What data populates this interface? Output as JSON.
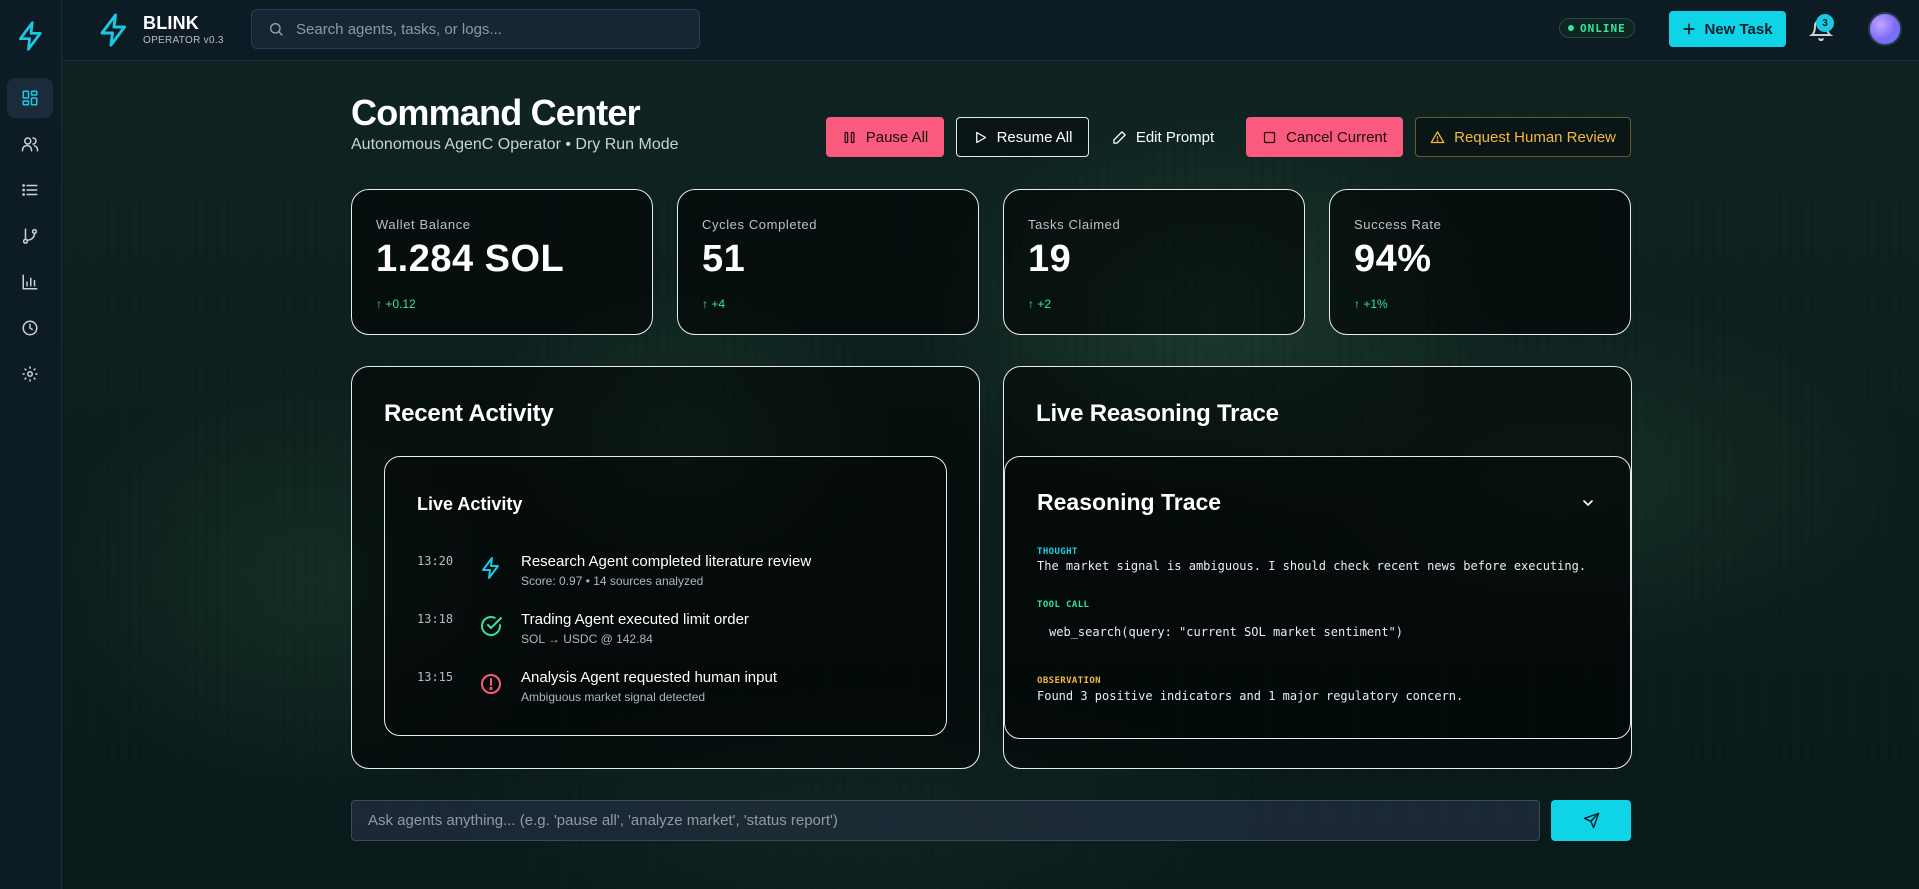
{
  "colors": {
    "accent": "#0fd4e8",
    "danger": "#fb5a7f",
    "warning": "#f5b740",
    "success": "#34e3a4",
    "thought_label": "#17d4e8",
    "tool_call_label": "#2ee6a2",
    "observation_label": "#f5b740"
  },
  "sidebar": {
    "items": [
      {
        "icon": "dashboard-icon",
        "active": true
      },
      {
        "icon": "users-icon",
        "active": false
      },
      {
        "icon": "list-icon",
        "active": false
      },
      {
        "icon": "git-branch-icon",
        "active": false
      },
      {
        "icon": "bar-chart-icon",
        "active": false
      },
      {
        "icon": "clock-icon",
        "active": false
      },
      {
        "icon": "settings-icon",
        "active": false
      }
    ]
  },
  "header": {
    "brand": "BLINK",
    "version": "OPERATOR v0.3",
    "search_placeholder": "Search agents, tasks, or logs...",
    "status": "ONLINE",
    "new_task_label": "New Task",
    "notification_count": "3"
  },
  "page": {
    "title": "Command Center",
    "subtitle": "Autonomous AgenC Operator • Dry Run Mode"
  },
  "actions": {
    "pause_all": "Pause All",
    "resume_all": "Resume All",
    "edit_prompt": "Edit Prompt",
    "cancel_current": "Cancel Current",
    "request_review": "Request Human Review"
  },
  "stats": [
    {
      "label": "Wallet Balance",
      "value": "1.284 SOL",
      "delta": "↑ +0.12"
    },
    {
      "label": "Cycles Completed",
      "value": "51",
      "delta": "↑ +4"
    },
    {
      "label": "Tasks Claimed",
      "value": "19",
      "delta": "↑ +2"
    },
    {
      "label": "Success Rate",
      "value": "94%",
      "delta": "↑ +1%"
    }
  ],
  "recent_activity": {
    "title": "Recent Activity",
    "live_title": "Live Activity",
    "items": [
      {
        "time": "13:20",
        "icon": "bolt-icon",
        "title": "Research Agent completed literature review",
        "detail": "Score: 0.97 • 14 sources analyzed"
      },
      {
        "time": "13:18",
        "icon": "check-circle-icon",
        "title": "Trading Agent executed limit order",
        "detail": "SOL → USDC @ 142.84"
      },
      {
        "time": "13:15",
        "icon": "alert-circle-icon",
        "title": "Analysis Agent requested human input",
        "detail": "Ambiguous market signal detected"
      }
    ]
  },
  "reasoning": {
    "title": "Live Reasoning Trace",
    "inner_title": "Reasoning Trace",
    "thought_label": "THOUGHT",
    "thought": "The market signal is ambiguous. I should check recent news before executing.",
    "tool_call_label": "TOOL CALL",
    "tool_call": "web_search(query: \"current SOL market sentiment\")",
    "observation_label": "OBSERVATION",
    "observation": "Found 3 positive indicators and 1 major regulatory concern."
  },
  "ask": {
    "placeholder": "Ask agents anything... (e.g. 'pause all', 'analyze market', 'status report')"
  }
}
